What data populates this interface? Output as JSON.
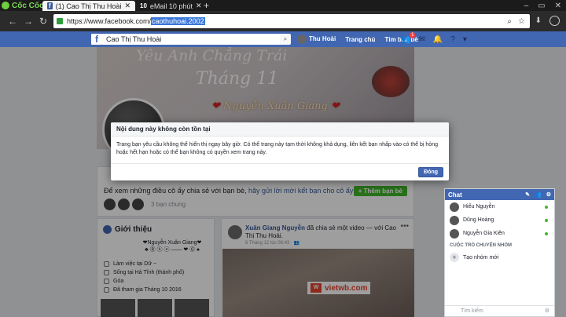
{
  "browser": {
    "brand": "Cốc Cốc",
    "tabs": [
      {
        "favicon": "f",
        "label": "(1) Cao Thị Thu Hoài"
      },
      {
        "favicon": "10",
        "label": "eMail 10 phút"
      }
    ],
    "url_prefix": "https://www.facebook.com/",
    "url_selected": "caothuhoai.2002"
  },
  "fb": {
    "search_value": "Cao Thị Thu Hoài",
    "nav": {
      "user": "Thu Hoài",
      "home": "Trang chủ",
      "find_friends": "Tìm bạn bè"
    },
    "friend_requests_count": "1"
  },
  "cover": {
    "line1": "Yêu Anh Chẳng Trái",
    "line2": "Tháng 11",
    "name": "Nguyễn Xuân Giang"
  },
  "friend_card": {
    "message_prefix": "Để xem những điều cô ấy chia sẻ với bạn bè,",
    "message_link": "hãy gửi lời mời kết bạn cho cô ấy",
    "add_button": "Thêm bạn bè",
    "mutual": "3 bạn chung"
  },
  "intro": {
    "title": "Giới thiệu",
    "bio_line1": "❤Nguyễn Xuân Giang❤",
    "bio_line2": "♣ Ⓡ ⓗ ⓔ —— ❤ Ⓖ ♠",
    "work": "Làm việc tại Dữ ~",
    "lives": "Sống tại Hà Tĩnh (thành phố)",
    "relationship": "Góa",
    "joined": "Đã tham gia Tháng 10 2016"
  },
  "post": {
    "author": "Xuân Giang Nguyễn",
    "action": "đã chia sẻ một video — với Cao Thị Thu Hoài.",
    "time": "6 Tháng 12 lúc 06:43 · ",
    "video_brand": "vietwb.com"
  },
  "chat": {
    "title": "Chat",
    "contacts": [
      "Hiếu Nguyễn",
      "Dũng Hoàng",
      "Nguyễn Gia Kiên"
    ],
    "section": "CUỘC TRÒ CHUYỆN NHÓM",
    "create_group": "Tạo nhóm mới",
    "search_placeholder": "Tìm kiếm"
  },
  "dialog": {
    "title": "Nội dung này không còn tồn tại",
    "body": "Trang bạn yêu cầu không thể hiển thị ngay bây giờ. Có thể trang này tạm thời không khả dụng, liên kết bạn nhấp vào có thể bị hỏng hoặc hết hạn hoặc có thể bạn không có quyền xem trang này.",
    "ok_button": "Đóng"
  }
}
